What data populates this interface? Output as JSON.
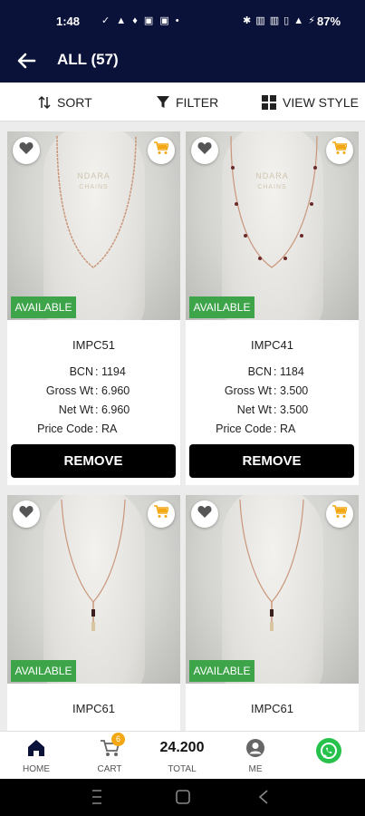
{
  "status_bar": {
    "time": "1:48",
    "left_icons": "✓ ▲ ♦ ▣ ▣ •",
    "right_icons": "✱ ▥ ▥ ▯ ▲ ⚡",
    "battery": "87%"
  },
  "header": {
    "title": "ALL (57)",
    "back_icon": "arrow-left-icon"
  },
  "toolbar": {
    "sort": "SORT",
    "filter": "FILTER",
    "view_style": "VIEW STYLE"
  },
  "colors": {
    "header_bg": "#0b1239",
    "available_bg": "#3da44a",
    "cart_accent": "#f3a712",
    "whatsapp": "#26c24b"
  },
  "products": [
    {
      "code": "IMPC51",
      "bcn_label": "BCN",
      "bcn": "1194",
      "gross_label": "Gross Wt",
      "gross": "6.960",
      "net_label": "Net Wt",
      "net": "6.960",
      "price_label": "Price Code",
      "price": "RA",
      "status": "AVAILABLE",
      "action": "REMOVE",
      "brand": "NDARA",
      "brand_sub": "CHAINS"
    },
    {
      "code": "IMPC41",
      "bcn_label": "BCN",
      "bcn": "1184",
      "gross_label": "Gross Wt",
      "gross": "3.500",
      "net_label": "Net Wt",
      "net": "3.500",
      "price_label": "Price Code",
      "price": "RA",
      "status": "AVAILABLE",
      "action": "REMOVE",
      "brand": "NDARA",
      "brand_sub": "CHAINS"
    },
    {
      "code": "IMPC61",
      "status": "AVAILABLE"
    },
    {
      "code": "IMPC61",
      "status": "AVAILABLE"
    }
  ],
  "bottom_nav": {
    "home": "HOME",
    "cart": "CART",
    "cart_count": "6",
    "total_value": "24.200",
    "total": "TOTAL",
    "me": "ME"
  }
}
